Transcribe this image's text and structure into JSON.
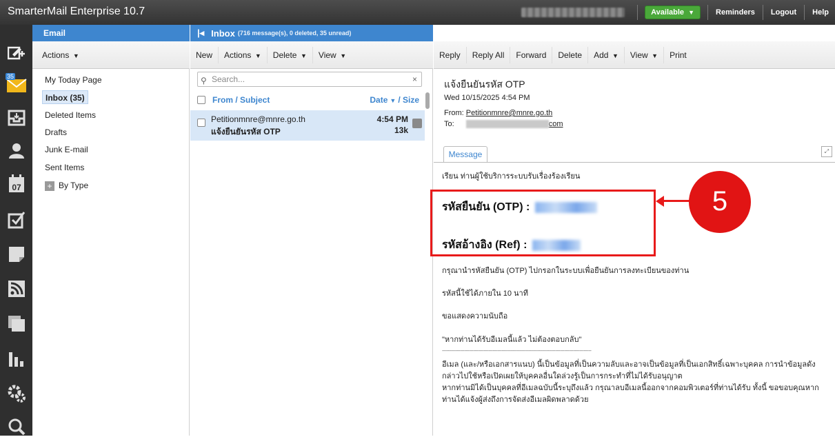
{
  "app": {
    "title": "SmarterMail Enterprise 10.7"
  },
  "topbar": {
    "status": "Available",
    "reminders": "Reminders",
    "logout": "Logout",
    "help": "Help"
  },
  "nav": {
    "calendar_day": "07",
    "email_badge": "35"
  },
  "folders_pane": {
    "header": "Email",
    "actions": "Actions",
    "items": [
      {
        "label": "My Today Page"
      },
      {
        "label": "Inbox (35)"
      },
      {
        "label": "Deleted Items"
      },
      {
        "label": "Drafts"
      },
      {
        "label": "Junk E-mail"
      },
      {
        "label": "Sent Items"
      },
      {
        "label": "By Type"
      }
    ]
  },
  "inbox": {
    "title": "Inbox",
    "summary": "(716 message(s), 0 deleted, 35 unread)",
    "toolbar": {
      "new": "New",
      "actions": "Actions",
      "delete": "Delete",
      "view": "View"
    },
    "search_placeholder": "Search...",
    "col_from": "From / Subject",
    "col_date": "Date",
    "col_size": "/ Size",
    "messages": [
      {
        "from": "Petitionmnre@mnre.go.th",
        "subject": "แจ้งยืนยันรหัส OTP",
        "time": "4:54 PM",
        "size": "13k"
      }
    ]
  },
  "reader": {
    "toolbar": {
      "reply": "Reply",
      "reply_all": "Reply All",
      "forward": "Forward",
      "delete": "Delete",
      "add": "Add",
      "view": "View",
      "print": "Print"
    },
    "subject": "แจ้งยืนยันรหัส OTP",
    "date": "Wed 10/15/2025 4:54 PM",
    "from_label": "From:",
    "from": "Petitionmnre@mnre.go.th",
    "to_label": "To:",
    "to_suffix": "com",
    "tab": "Message",
    "greeting": "เรียน ท่านผู้ใช้บริการระบบรับเรื่องร้องเรียน",
    "otp_label": "รหัสยืนยัน (OTP) :",
    "ref_label": "รหัสอ้างอิง (Ref) :",
    "line1": "กรุณานำรหัสยืนยัน (OTP) ไปกรอกในระบบเพื่อยืนยันการลงทะเบียนของท่าน",
    "line2": "รหัสนี้ใช้ได้ภายใน 10 นาที",
    "line3": "ขอแสดงความนับถือ",
    "line4": "\"หากท่านได้รับอีเมลนี้แล้ว ไม่ต้องตอบกลับ\"",
    "divider": "----------------------------------------------------------------------------------------------------",
    "disclaimer1": "อีเมล (และ/หรือเอกสารแนบ) นี้เป็นข้อมูลที่เป็นความลับและอาจเป็นข้อมูลที่เป็นเอกสิทธิ์เฉพาะบุคคล การนำข้อมูลดัง",
    "disclaimer2": "กล่าวไปใช้หรือเปิดเผยให้บุคคลอื่นใดล่วงรู้เป็นการกระทำที่ไม่ได้รับอนุญาต",
    "disclaimer3": "หากท่านมิได้เป็นบุคคลที่อีเมลฉบับนี้ระบุถึงแล้ว กรุณาลบอีเมลนี้ออกจากคอมพิวเตอร์ที่ท่านได้รับ ทั้งนี้ ขอขอบคุณหาก",
    "disclaimer4": "ท่านได้แจ้งผู้ส่งถึงการจัดส่งอีเมลผิดพลาดด้วย"
  },
  "annotation": {
    "callout_number": "5",
    "highlight_color": "#e81a1a"
  }
}
